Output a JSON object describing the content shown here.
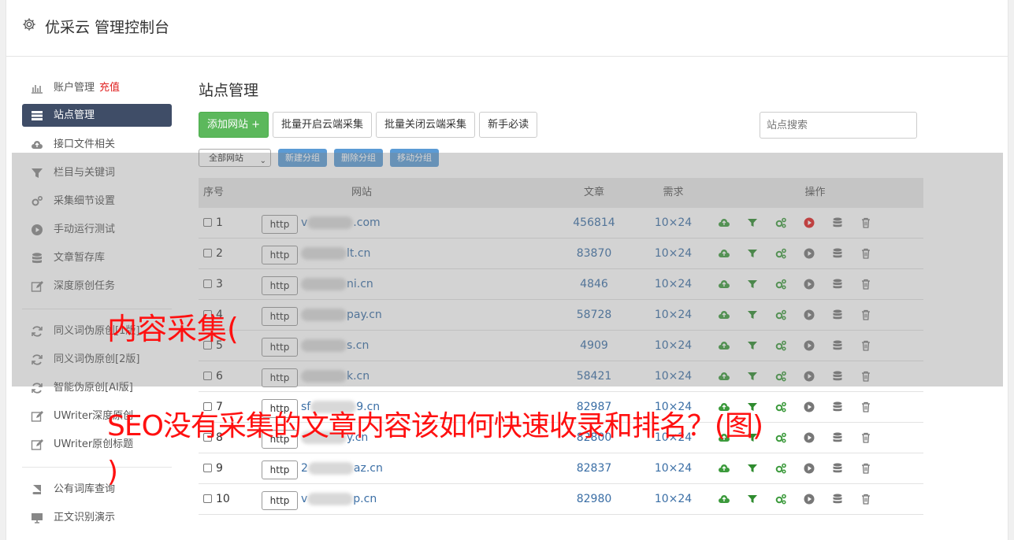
{
  "app": {
    "title": "优采云 管理控制台"
  },
  "sidebar": {
    "items": [
      {
        "label": "账户管理",
        "extra": "充值",
        "icon": "bar-chart-icon"
      },
      {
        "label": "站点管理",
        "icon": "server-icon",
        "active": true
      },
      {
        "label": "接口文件相关",
        "icon": "cloud-upload-icon"
      },
      {
        "label": "栏目与关键词",
        "icon": "filter-icon"
      },
      {
        "label": "采集细节设置",
        "icon": "gears-icon"
      },
      {
        "label": "手动运行测试",
        "icon": "play-circle-icon"
      },
      {
        "label": "文章暂存库",
        "icon": "database-icon"
      },
      {
        "label": "深度原创任务",
        "icon": "edit-icon"
      }
    ],
    "items2": [
      {
        "label": "同义词伪原创[1版]",
        "icon": "refresh-icon"
      },
      {
        "label": "同义词伪原创[2版]",
        "icon": "refresh-icon"
      },
      {
        "label": "智能伪原创[AI版]",
        "icon": "refresh-icon"
      },
      {
        "label": "UWriter深度原创",
        "icon": "edit-icon"
      },
      {
        "label": "UWriter原创标题",
        "icon": "edit-icon"
      }
    ],
    "items3": [
      {
        "label": "公有词库查询",
        "icon": "book-icon"
      },
      {
        "label": "正文识别演示",
        "icon": "monitor-icon"
      }
    ]
  },
  "main": {
    "title": "站点管理",
    "buttons": {
      "add": "添加网站 +",
      "batch_open": "批量开启云端采集",
      "batch_close": "批量关闭云端采集",
      "guide": "新手必读"
    },
    "search_placeholder": "站点搜索",
    "group_select": "全部网站",
    "group_buttons": {
      "new": "新建分组",
      "delete": "删除分组",
      "move": "移动分组"
    },
    "table": {
      "headers": {
        "no": "序号",
        "site": "网站",
        "articles": "文章",
        "demand": "需求",
        "ops": "操作"
      },
      "rows": [
        {
          "no": "1",
          "proto": "http",
          "prefix": "v",
          "suffix": ".com",
          "articles": "456814",
          "demand": "10×24",
          "play_active": true
        },
        {
          "no": "2",
          "proto": "http",
          "prefix": "",
          "suffix": "lt.cn",
          "articles": "83870",
          "demand": "10×24",
          "play_active": false
        },
        {
          "no": "3",
          "proto": "http",
          "prefix": "",
          "suffix": "ni.cn",
          "articles": "4846",
          "demand": "10×24",
          "play_active": false
        },
        {
          "no": "4",
          "proto": "http",
          "prefix": "",
          "suffix": "pay.cn",
          "articles": "58728",
          "demand": "10×24",
          "play_active": false
        },
        {
          "no": "5",
          "proto": "http",
          "prefix": "",
          "suffix": "s.cn",
          "articles": "4909",
          "demand": "10×24",
          "play_active": false
        },
        {
          "no": "6",
          "proto": "http",
          "prefix": "",
          "suffix": "k.cn",
          "articles": "58421",
          "demand": "10×24",
          "play_active": false
        },
        {
          "no": "7",
          "proto": "http",
          "prefix": "sf",
          "suffix": "9.cn",
          "articles": "82987",
          "demand": "10×24",
          "play_active": false
        },
        {
          "no": "8",
          "proto": "http",
          "prefix": "",
          "suffix": "y.cn",
          "articles": "82800",
          "demand": "10×24",
          "play_active": false
        },
        {
          "no": "9",
          "proto": "http",
          "prefix": "2",
          "suffix": "az.cn",
          "articles": "82837",
          "demand": "10×24",
          "play_active": false
        },
        {
          "no": "10",
          "proto": "http",
          "prefix": "v",
          "suffix": "p.cn",
          "articles": "82980",
          "demand": "10×24",
          "play_active": false
        }
      ]
    }
  },
  "overlay": {
    "line1": "内容采集(",
    "line2": "SEO没有采集的文章内容该如何快速收录和排名？(图)",
    "line3": ")"
  },
  "colors": {
    "accent_green": "#5cb85c",
    "sidebar_active": "#3f4d67",
    "link_blue": "#3a6ea5",
    "overlay_red": "#ff1010"
  }
}
